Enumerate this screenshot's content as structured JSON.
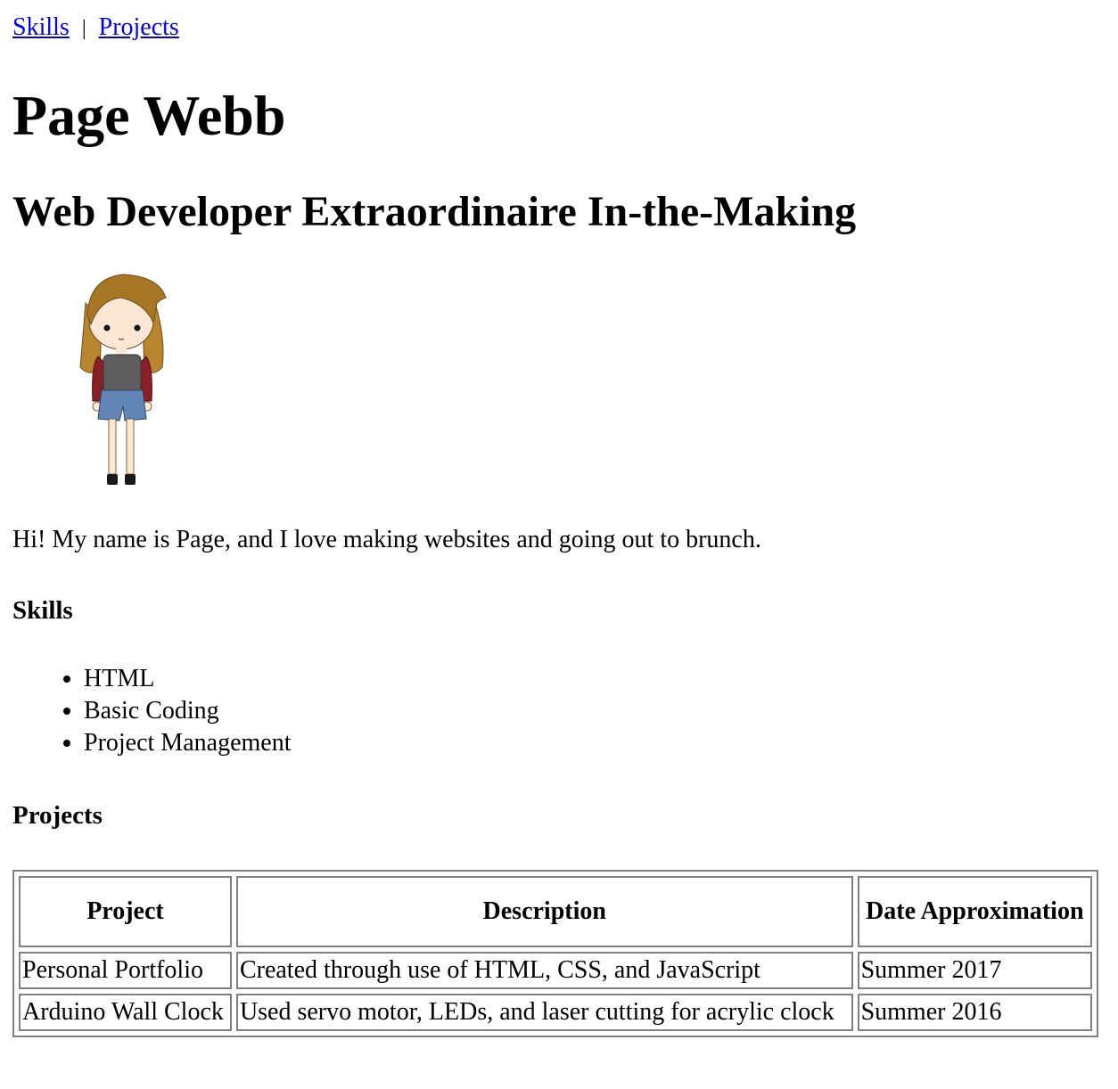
{
  "nav": {
    "links": [
      "Skills",
      "Projects"
    ],
    "separator": "|"
  },
  "header": {
    "name": "Page Webb",
    "tagline": "Web Developer Extraordinaire In-the-Making"
  },
  "intro": "Hi! My name is Page, and I love making websites and going out to brunch.",
  "skills": {
    "heading": "Skills",
    "items": [
      "HTML",
      "Basic Coding",
      "Project Management"
    ]
  },
  "projects": {
    "heading": "Projects",
    "columns": [
      "Project",
      "Description",
      "Date Approximation"
    ],
    "rows": [
      [
        "Personal Portfolio",
        "Created through use of HTML, CSS, and JavaScript",
        "Summer 2017"
      ],
      [
        "Arduino Wall Clock",
        "Used servo motor, LEDs, and laser cutting for acrylic clock",
        "Summer 2016"
      ]
    ]
  },
  "colors": {
    "link": "#0000ee",
    "table_border": "#808080",
    "hair": "#b8862e",
    "sleeves": "#8b1f26",
    "shirt": "#5e5e5e",
    "shorts": "#5f86b7"
  }
}
